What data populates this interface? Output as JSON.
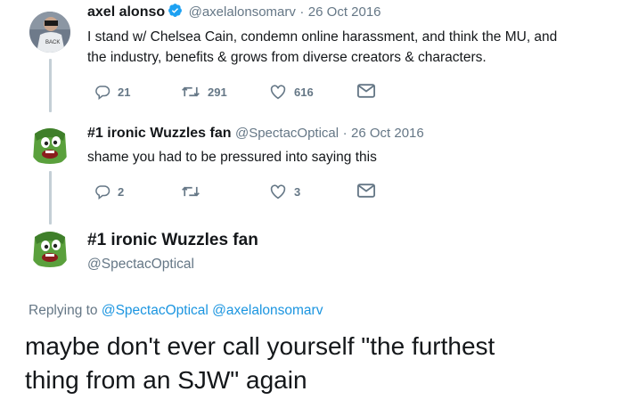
{
  "tweet1": {
    "name": "axel alonso",
    "handle": "@axelalonsomarv",
    "sep": "·",
    "date": "26 Oct 2016",
    "text_line1": "I stand w/ Chelsea Cain, condemn online harassment, and think the MU, and",
    "text_line2": "the industry, benefits & grows from diverse creators & characters.",
    "replies": "21",
    "retweets": "291",
    "likes": "616",
    "verified": true
  },
  "tweet2": {
    "name": "#1 ironic Wuzzles fan",
    "handle": "@SpectacOptical",
    "sep": "·",
    "date": "26 Oct 2016",
    "text": "shame you had to be pressured into saying this",
    "replies": "2",
    "retweets": "",
    "likes": "3"
  },
  "main_tweet": {
    "name": "#1 ironic Wuzzles fan",
    "handle": "@SpectacOptical",
    "replying_prefix": "Replying to",
    "replying_to_1": "@SpectacOptical",
    "replying_to_2": "@axelalonsomarv",
    "text_line1": "maybe don't ever call yourself \"the furthest",
    "text_line2": "thing from an SJW\" again"
  },
  "colors": {
    "text": "#14171a",
    "muted": "#657786",
    "link": "#1b95e0",
    "verified": "#1da1f2",
    "thread_line": "#c4cfd6",
    "avatar_green": "#5aa03c"
  },
  "icons": [
    "reply-icon",
    "retweet-icon",
    "like-icon",
    "dm-icon",
    "verified-badge-icon"
  ]
}
